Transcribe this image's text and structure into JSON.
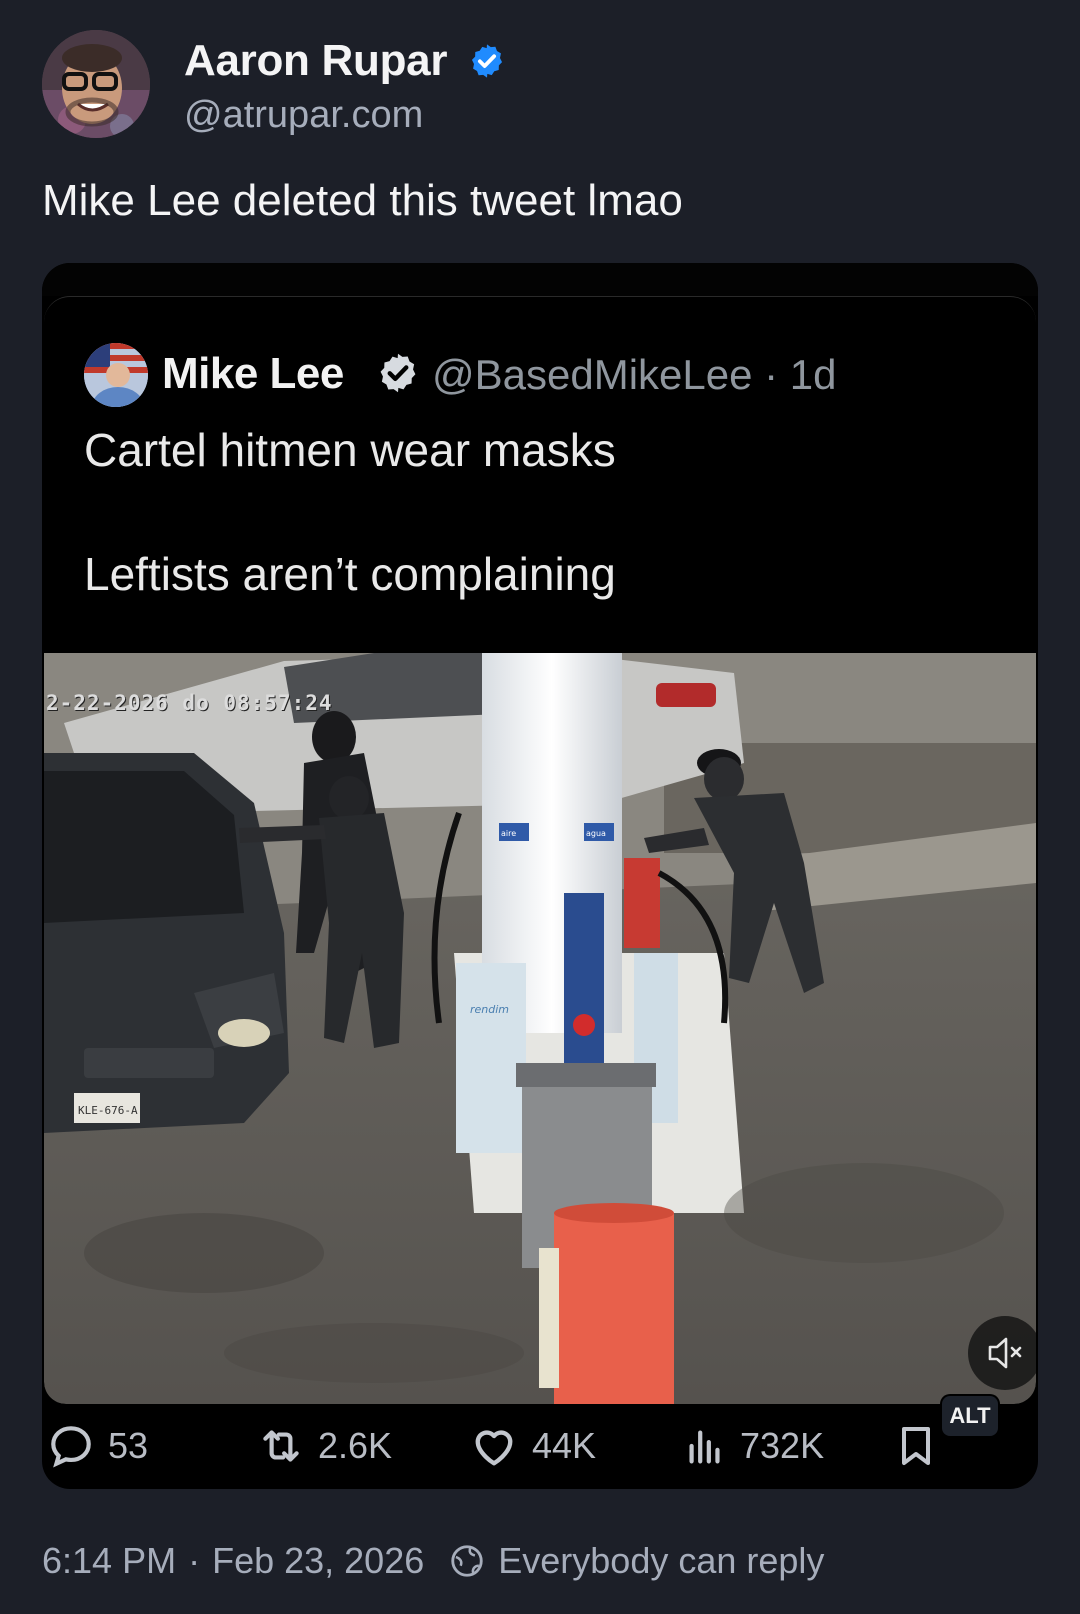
{
  "author": {
    "name": "Aaron Rupar",
    "handle": "@atrupar.com",
    "verified": true
  },
  "post": {
    "text": "Mike Lee deleted this tweet lmao"
  },
  "quoted": {
    "name": "Mike Lee",
    "handle_time": "@BasedMikeLee · 1d",
    "line1": "Cartel hitmen wear masks",
    "line2": "Leftists aren’t complaining",
    "timestamp_overlay": "2-22-2026 do 08:57:24",
    "plate": "KLE-676-A",
    "pump_label_left": "aire",
    "pump_label_right": "agua",
    "pump_sign": "rendim"
  },
  "actions": {
    "replies": "53",
    "reposts": "2.6K",
    "likes": "44K",
    "views": "732K",
    "alt": "ALT"
  },
  "footer": {
    "time": "6:14 PM",
    "date": "Feb 23, 2026",
    "reply_setting": "Everybody can reply"
  },
  "colors": {
    "background": "#1c1f28",
    "verified_blue": "#208bfe",
    "muted_text": "#a6adbb"
  },
  "icons": [
    "verified-badge-icon",
    "reply-icon",
    "repost-icon",
    "like-icon",
    "views-icon",
    "bookmark-icon",
    "mute-icon",
    "globe-icon"
  ]
}
